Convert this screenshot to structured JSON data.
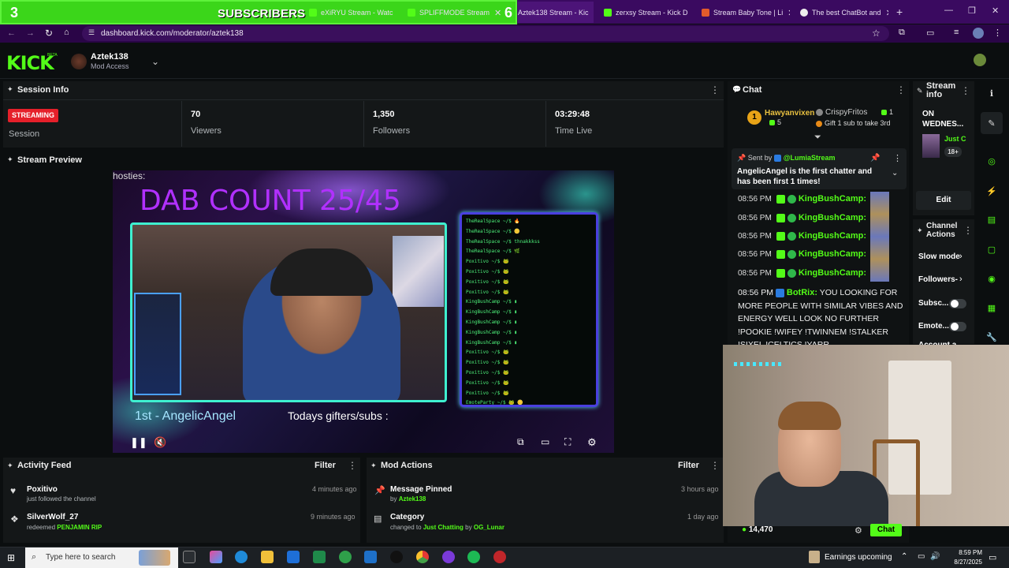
{
  "browser": {
    "overlay": {
      "count_left": "3",
      "label": "SUBSCRIBERS",
      "count_right": "6"
    },
    "tabs": [
      {
        "title": "eXiRYU Stream - Watc",
        "color": "#53fc18"
      },
      {
        "title": "SPLIFFMODE Stream",
        "color": "#53fc18"
      },
      {
        "title": "Aztek138 Stream - Kic",
        "color": "#53fc18"
      },
      {
        "title": "zerxsy Stream - Kick D",
        "color": "#53fc18"
      },
      {
        "title": "Stream Baby Tone | Li",
        "color": "#e25b2b"
      },
      {
        "title": "The best ChatBot and",
        "color": "#eeeeee"
      }
    ],
    "url": "dashboard.kick.com/moderator/aztek138"
  },
  "header": {
    "logo": "KICK",
    "beta": "BETA",
    "username": "Aztek138",
    "role": "Mod Access"
  },
  "session": {
    "title": "Session Info",
    "badge": "STREAMING",
    "label": "Session",
    "stats": [
      {
        "value": "70",
        "label": "Viewers"
      },
      {
        "value": "1,350",
        "label": "Followers"
      },
      {
        "value": "03:29:48",
        "label": "Time Live"
      }
    ]
  },
  "preview": {
    "title": "Stream Preview",
    "hosties": "hosties:",
    "dab": "DAB COUNT 25/45",
    "first": "1st - AngelicAngel",
    "gifters": "Todays gifters/subs :",
    "chatlog": [
      "TheRealSpace ~/$ 🔥",
      "TheRealSpace ~/$ 🪙",
      "TheRealSpace ~/$ thnakkkss",
      "TheRealSpace ~/$ 🌿",
      "Poxitivo ~/$ 🐸",
      "Poxitivo ~/$ 🐸",
      "Poxitivo ~/$ 🐸",
      "Poxitivo ~/$ 🐸",
      "KingBushCamp ~/$ ▮",
      "KingBushCamp ~/$ ▮",
      "KingBushCamp ~/$ ▮",
      "KingBushCamp ~/$ ▮",
      "KingBushCamp ~/$ ▮",
      "Poxitivo ~/$ 🐸",
      "Poxitivo ~/$ 🐸",
      "Poxitivo ~/$ 🐸",
      "Poxitivo ~/$ 🐸",
      "Poxitivo ~/$ 🐸",
      "EmoteParty ~/$ 🐸 🪙"
    ]
  },
  "activity": {
    "title": "Activity Feed",
    "filter": "Filter",
    "items": [
      {
        "name": "Poxitivo",
        "sub": "just followed the channel",
        "sub_highlight": "",
        "time": "4 minutes ago"
      },
      {
        "name": "SilverWolf_27",
        "sub": "redeemed",
        "sub_highlight": "PENJAMIN RIP",
        "time": "9 minutes ago"
      }
    ]
  },
  "modactions": {
    "title": "Mod Actions",
    "filter": "Filter",
    "items": [
      {
        "name": "Message Pinned",
        "pre": "by",
        "hl": "Aztek138",
        "mid": "",
        "hl2": "",
        "time": "3 hours ago"
      },
      {
        "name": "Category",
        "pre": "changed to",
        "hl": "Just Chatting",
        "mid": "by",
        "hl2": "OG_Lunar",
        "time": "1 day ago"
      }
    ]
  },
  "chat": {
    "title": "Chat",
    "leader1": {
      "rank": "1",
      "name": "Hawyanvixen",
      "count": "5"
    },
    "leader2": {
      "name": "CrispyFritos",
      "count": "1",
      "note": "Gift 1 sub to take 3rd"
    },
    "pinned": {
      "sent_by": "Sent by",
      "by_name": "@LumiaStream",
      "text": "AngelicAngel is the first chatter and has been first 1 times!"
    },
    "messages": [
      {
        "time": "08:56 PM",
        "name": "KingBushCamp:"
      },
      {
        "time": "08:56 PM",
        "name": "KingBushCamp:"
      },
      {
        "time": "08:56 PM",
        "name": "KingBushCamp:"
      },
      {
        "time": "08:56 PM",
        "name": "KingBushCamp:"
      },
      {
        "time": "08:56 PM",
        "name": "KingBushCamp:"
      }
    ],
    "bot": {
      "time": "08:56 PM",
      "name": "BotRix:",
      "text": "YOU LOOKING FOR MORE PEOPLE WITH SIMILAR VIBES AND ENERGY WELL LOOK NO FURTHER !POOKIE !WIFEY !TWINNEM !STALKER !SIXEL !CELTICS !YARR"
    },
    "viewers": "14,470",
    "chat_btn": "Chat"
  },
  "streaminfo": {
    "title": "Stream info",
    "line1": "ON",
    "line2": "WEDNES...",
    "channel": "Just C",
    "rating": "18+",
    "edit": "Edit"
  },
  "channelactions": {
    "title": "Channel Actions",
    "items": [
      {
        "label": "Slow mode",
        "kind": "arrow"
      },
      {
        "label": "Followers-",
        "kind": "arrow"
      },
      {
        "label": "Subsc...",
        "kind": "toggle"
      },
      {
        "label": "Emote...",
        "kind": "toggle"
      },
      {
        "label": "Account a",
        "kind": "none"
      }
    ]
  },
  "taskbar": {
    "search": "Type here to search",
    "earnings": "Earnings upcoming",
    "time": "8:59 PM",
    "date": "8/27/2025"
  },
  "colors": {
    "kick_green": "#53fc18",
    "streaming_red": "#e5202a",
    "browser_purple": "#3a0a60"
  }
}
